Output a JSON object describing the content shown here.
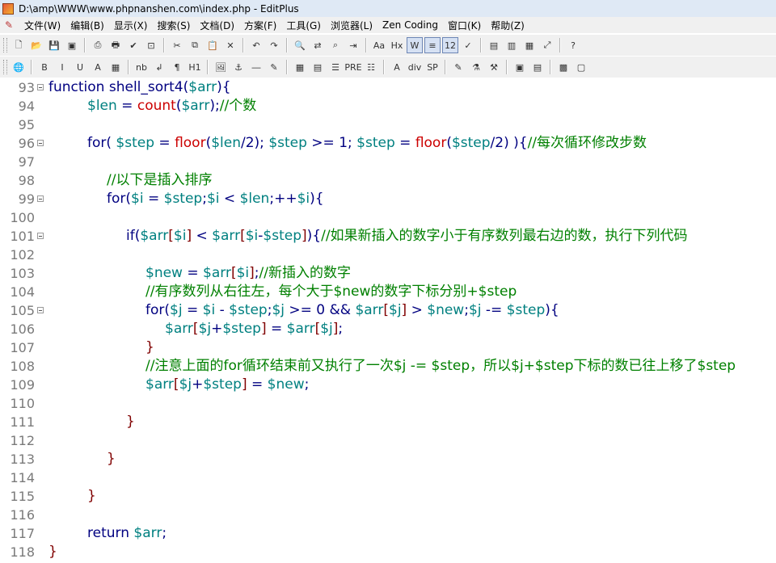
{
  "window": {
    "title": "D:\\amp\\WWW\\www.phpnanshen.com\\index.php - EditPlus"
  },
  "menu": [
    {
      "label": "文件(W)"
    },
    {
      "label": "编辑(B)"
    },
    {
      "label": "显示(X)"
    },
    {
      "label": "搜索(S)"
    },
    {
      "label": "文档(D)"
    },
    {
      "label": "方案(F)"
    },
    {
      "label": "工具(G)"
    },
    {
      "label": "浏览器(L)"
    },
    {
      "label": "Zen Coding"
    },
    {
      "label": "窗口(K)"
    },
    {
      "label": "帮助(Z)"
    }
  ],
  "toolbar1": [
    {
      "name": "new-file-icon",
      "glyph": "🗋"
    },
    {
      "name": "open-file-icon",
      "glyph": "📂"
    },
    {
      "name": "save-icon",
      "glyph": "💾"
    },
    {
      "name": "save-all-icon",
      "glyph": "▣"
    },
    {
      "sep": true
    },
    {
      "name": "print-preview-icon",
      "glyph": "⎙"
    },
    {
      "name": "print-icon",
      "glyph": "🖶"
    },
    {
      "name": "spellcheck-icon",
      "glyph": "✔"
    },
    {
      "name": "browser-preview-icon",
      "glyph": "⊡"
    },
    {
      "sep": true
    },
    {
      "name": "cut-icon",
      "glyph": "✂"
    },
    {
      "name": "copy-icon",
      "glyph": "⧉"
    },
    {
      "name": "paste-icon",
      "glyph": "📋"
    },
    {
      "name": "delete-icon",
      "glyph": "✕"
    },
    {
      "sep": true
    },
    {
      "name": "undo-icon",
      "glyph": "↶"
    },
    {
      "name": "redo-icon",
      "glyph": "↷"
    },
    {
      "sep": true
    },
    {
      "name": "find-icon",
      "glyph": "🔍"
    },
    {
      "name": "replace-icon",
      "glyph": "⇄"
    },
    {
      "name": "find-in-files-icon",
      "glyph": "⌕"
    },
    {
      "name": "goto-line-icon",
      "glyph": "⇥"
    },
    {
      "sep": true
    },
    {
      "name": "font-icon",
      "glyph": "Aa"
    },
    {
      "name": "heading-icon",
      "glyph": "Hx"
    },
    {
      "name": "word-wrap-icon",
      "glyph": "W",
      "active": true
    },
    {
      "name": "ruler-icon",
      "glyph": "≡",
      "active": true
    },
    {
      "name": "line-number-icon",
      "glyph": "12",
      "active": true
    },
    {
      "name": "checkmark-icon",
      "glyph": "✓"
    },
    {
      "sep": true
    },
    {
      "name": "directory-icon",
      "glyph": "▤"
    },
    {
      "name": "cliptext-icon",
      "glyph": "▥"
    },
    {
      "name": "output-icon",
      "glyph": "▦"
    },
    {
      "name": "fullscreen-icon",
      "glyph": "⤢"
    },
    {
      "sep": true
    },
    {
      "name": "help-icon",
      "glyph": "?"
    }
  ],
  "toolbar2": [
    {
      "name": "web-icon",
      "glyph": "🌐"
    },
    {
      "sep": true
    },
    {
      "name": "bold-icon",
      "glyph": "B"
    },
    {
      "name": "italic-icon",
      "glyph": "I"
    },
    {
      "name": "underline-icon",
      "glyph": "U"
    },
    {
      "name": "font-color-icon",
      "glyph": "A"
    },
    {
      "name": "color-picker-icon",
      "glyph": "▦"
    },
    {
      "sep": true
    },
    {
      "name": "nbsp-icon",
      "glyph": "nb"
    },
    {
      "name": "linebreak-icon",
      "glyph": "↲"
    },
    {
      "name": "paragraph-icon",
      "glyph": "¶"
    },
    {
      "name": "heading-tag-icon",
      "glyph": "H1"
    },
    {
      "sep": true
    },
    {
      "name": "image-icon",
      "glyph": "🖼"
    },
    {
      "name": "anchor-icon",
      "glyph": "⚓"
    },
    {
      "name": "hr-icon",
      "glyph": "―"
    },
    {
      "name": "comment-icon",
      "glyph": "✎"
    },
    {
      "sep": true
    },
    {
      "name": "table-icon",
      "glyph": "▦"
    },
    {
      "name": "form-icon",
      "glyph": "▤"
    },
    {
      "name": "center-icon",
      "glyph": "☰"
    },
    {
      "name": "pre-icon",
      "glyph": "PRE"
    },
    {
      "name": "list-icon",
      "glyph": "☷"
    },
    {
      "sep": true
    },
    {
      "name": "abbr-icon",
      "glyph": "A"
    },
    {
      "name": "div-icon",
      "glyph": "div"
    },
    {
      "name": "span-icon",
      "glyph": "SP"
    },
    {
      "sep": true
    },
    {
      "name": "edit-icon",
      "glyph": "✎"
    },
    {
      "name": "wand-icon",
      "glyph": "⚗"
    },
    {
      "name": "tools-icon",
      "glyph": "⚒"
    },
    {
      "sep": true
    },
    {
      "name": "layout-icon",
      "glyph": "▣"
    },
    {
      "name": "panel-icon",
      "glyph": "▤"
    },
    {
      "sep": true
    },
    {
      "name": "palette-icon",
      "glyph": "▩"
    },
    {
      "name": "window-icon",
      "glyph": "▢"
    }
  ],
  "lines": [
    {
      "n": "93",
      "fold": true,
      "indent": 60,
      "tokens": [
        [
          "kw",
          "function shell_sort4("
        ],
        [
          "var",
          "$arr"
        ],
        [
          "kw",
          "){"
        ]
      ]
    },
    {
      "n": "94",
      "fold": false,
      "indent": 108,
      "tokens": [
        [
          "var",
          "$len"
        ],
        [
          "op",
          " = "
        ],
        [
          "fn",
          "count"
        ],
        [
          "kw",
          "("
        ],
        [
          "var",
          "$arr"
        ],
        [
          "kw",
          ");"
        ],
        [
          "cm",
          "//个数"
        ]
      ]
    },
    {
      "n": "95",
      "fold": false,
      "indent": 108,
      "tokens": []
    },
    {
      "n": "96",
      "fold": true,
      "indent": 108,
      "tokens": [
        [
          "kw",
          "for( "
        ],
        [
          "var",
          "$step"
        ],
        [
          "op",
          " = "
        ],
        [
          "fn",
          "floor"
        ],
        [
          "kw",
          "("
        ],
        [
          "var",
          "$len"
        ],
        [
          "kw",
          "/2); "
        ],
        [
          "var",
          "$step"
        ],
        [
          "op",
          " >= 1; "
        ],
        [
          "var",
          "$step"
        ],
        [
          "op",
          " = "
        ],
        [
          "fn",
          "floor"
        ],
        [
          "kw",
          "("
        ],
        [
          "var",
          "$step"
        ],
        [
          "kw",
          "/2) ){"
        ],
        [
          "cm",
          "//每次循环修改步数"
        ]
      ]
    },
    {
      "n": "97",
      "fold": false,
      "indent": 108,
      "tokens": []
    },
    {
      "n": "98",
      "fold": false,
      "indent": 132,
      "tokens": [
        [
          "cm",
          "//以下是插入排序"
        ]
      ]
    },
    {
      "n": "99",
      "fold": true,
      "indent": 132,
      "tokens": [
        [
          "kw",
          "for("
        ],
        [
          "var",
          "$i"
        ],
        [
          "op",
          " = "
        ],
        [
          "var",
          "$step"
        ],
        [
          "kw",
          ";"
        ],
        [
          "var",
          "$i"
        ],
        [
          "op",
          " < "
        ],
        [
          "var",
          "$len"
        ],
        [
          "kw",
          ";++"
        ],
        [
          "var",
          "$i"
        ],
        [
          "kw",
          "){"
        ]
      ]
    },
    {
      "n": "100",
      "fold": false,
      "indent": 132,
      "tokens": []
    },
    {
      "n": "101",
      "fold": true,
      "indent": 156,
      "tokens": [
        [
          "kw",
          "if("
        ],
        [
          "var",
          "$arr"
        ],
        [
          "br",
          "["
        ],
        [
          "var",
          "$i"
        ],
        [
          "br",
          "]"
        ],
        [
          "op",
          " < "
        ],
        [
          "var",
          "$arr"
        ],
        [
          "br",
          "["
        ],
        [
          "var",
          "$i"
        ],
        [
          "op",
          "-"
        ],
        [
          "var",
          "$step"
        ],
        [
          "br",
          "]"
        ],
        [
          "kw",
          "){"
        ],
        [
          "cm",
          "//如果新插入的数字小于有序数列最右边的数，执行下列代码"
        ]
      ]
    },
    {
      "n": "102",
      "fold": false,
      "indent": 156,
      "tokens": []
    },
    {
      "n": "103",
      "fold": false,
      "indent": 180,
      "tokens": [
        [
          "var",
          "$new"
        ],
        [
          "op",
          " = "
        ],
        [
          "var",
          "$arr"
        ],
        [
          "br",
          "["
        ],
        [
          "var",
          "$i"
        ],
        [
          "br",
          "]"
        ],
        [
          "kw",
          ";"
        ],
        [
          "cm",
          "//新插入的数字"
        ]
      ]
    },
    {
      "n": "104",
      "fold": false,
      "indent": 180,
      "tokens": [
        [
          "cm",
          "//有序数列从右往左，每个大于$new的数字下标分别+$step"
        ]
      ]
    },
    {
      "n": "105",
      "fold": true,
      "indent": 180,
      "tokens": [
        [
          "kw",
          "for("
        ],
        [
          "var",
          "$j"
        ],
        [
          "op",
          " = "
        ],
        [
          "var",
          "$i"
        ],
        [
          "op",
          " - "
        ],
        [
          "var",
          "$step"
        ],
        [
          "kw",
          ";"
        ],
        [
          "var",
          "$j"
        ],
        [
          "op",
          " >= 0 && "
        ],
        [
          "var",
          "$arr"
        ],
        [
          "br",
          "["
        ],
        [
          "var",
          "$j"
        ],
        [
          "br",
          "]"
        ],
        [
          "op",
          " > "
        ],
        [
          "var",
          "$new"
        ],
        [
          "kw",
          ";"
        ],
        [
          "var",
          "$j"
        ],
        [
          "op",
          " -= "
        ],
        [
          "var",
          "$step"
        ],
        [
          "kw",
          "){"
        ]
      ]
    },
    {
      "n": "106",
      "fold": false,
      "indent": 204,
      "tokens": [
        [
          "var",
          "$arr"
        ],
        [
          "br",
          "["
        ],
        [
          "var",
          "$j"
        ],
        [
          "op",
          "+"
        ],
        [
          "var",
          "$step"
        ],
        [
          "br",
          "]"
        ],
        [
          "op",
          " = "
        ],
        [
          "var",
          "$arr"
        ],
        [
          "br",
          "["
        ],
        [
          "var",
          "$j"
        ],
        [
          "br",
          "]"
        ],
        [
          "kw",
          ";"
        ]
      ]
    },
    {
      "n": "107",
      "fold": false,
      "indent": 180,
      "tokens": [
        [
          "br",
          "}"
        ]
      ]
    },
    {
      "n": "108",
      "fold": false,
      "indent": 180,
      "tokens": [
        [
          "cm",
          "//注意上面的for循环结束前又执行了一次$j -= $step，所以$j+$step下标的数已往上移了$step"
        ]
      ]
    },
    {
      "n": "109",
      "fold": false,
      "indent": 180,
      "tokens": [
        [
          "var",
          "$arr"
        ],
        [
          "br",
          "["
        ],
        [
          "var",
          "$j"
        ],
        [
          "op",
          "+"
        ],
        [
          "var",
          "$step"
        ],
        [
          "br",
          "]"
        ],
        [
          "op",
          " = "
        ],
        [
          "var",
          "$new"
        ],
        [
          "kw",
          ";"
        ]
      ]
    },
    {
      "n": "110",
      "fold": false,
      "indent": 156,
      "tokens": []
    },
    {
      "n": "111",
      "fold": false,
      "indent": 156,
      "tokens": [
        [
          "br",
          "}"
        ]
      ]
    },
    {
      "n": "112",
      "fold": false,
      "indent": 132,
      "tokens": []
    },
    {
      "n": "113",
      "fold": false,
      "indent": 132,
      "tokens": [
        [
          "br",
          "}"
        ]
      ]
    },
    {
      "n": "114",
      "fold": false,
      "indent": 108,
      "tokens": []
    },
    {
      "n": "115",
      "fold": false,
      "indent": 108,
      "tokens": [
        [
          "br",
          "}"
        ]
      ]
    },
    {
      "n": "116",
      "fold": false,
      "indent": 108,
      "tokens": []
    },
    {
      "n": "117",
      "fold": false,
      "indent": 108,
      "tokens": [
        [
          "kw",
          "return "
        ],
        [
          "var",
          "$arr"
        ],
        [
          "kw",
          ";"
        ]
      ]
    },
    {
      "n": "118",
      "fold": false,
      "indent": 60,
      "tokens": [
        [
          "br",
          "}"
        ]
      ]
    }
  ]
}
